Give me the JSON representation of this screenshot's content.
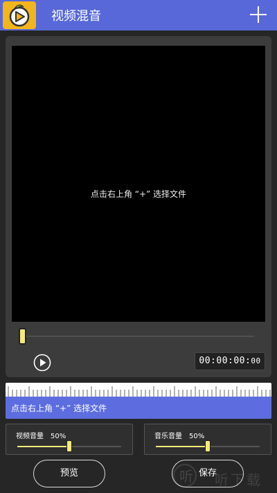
{
  "header": {
    "title": "视频混音",
    "logo_icon": "mango-play-logo",
    "add_icon": "plus-icon",
    "bg_color": "#5868d8"
  },
  "player": {
    "hint": "点击右上角 “+” 选择文件",
    "time_main": "00:00:00:",
    "time_ms": "00",
    "play_icon": "play-circle-icon",
    "progress": 0
  },
  "timeline": {
    "track_text": "点击右上角 “+” 选择文件"
  },
  "video_volume": {
    "label": "视频音量",
    "value_text": "50%",
    "value": 0.5
  },
  "music_volume": {
    "label": "音乐音量",
    "value_text": "50%",
    "value": 0.5
  },
  "buttons": {
    "preview": "预览",
    "save": "保存"
  },
  "watermark": {
    "text": "听下载"
  },
  "colors": {
    "accent": "#5d6de0",
    "slider_thumb": "#f4ea7c",
    "logo_bg": "#f2b51b"
  }
}
